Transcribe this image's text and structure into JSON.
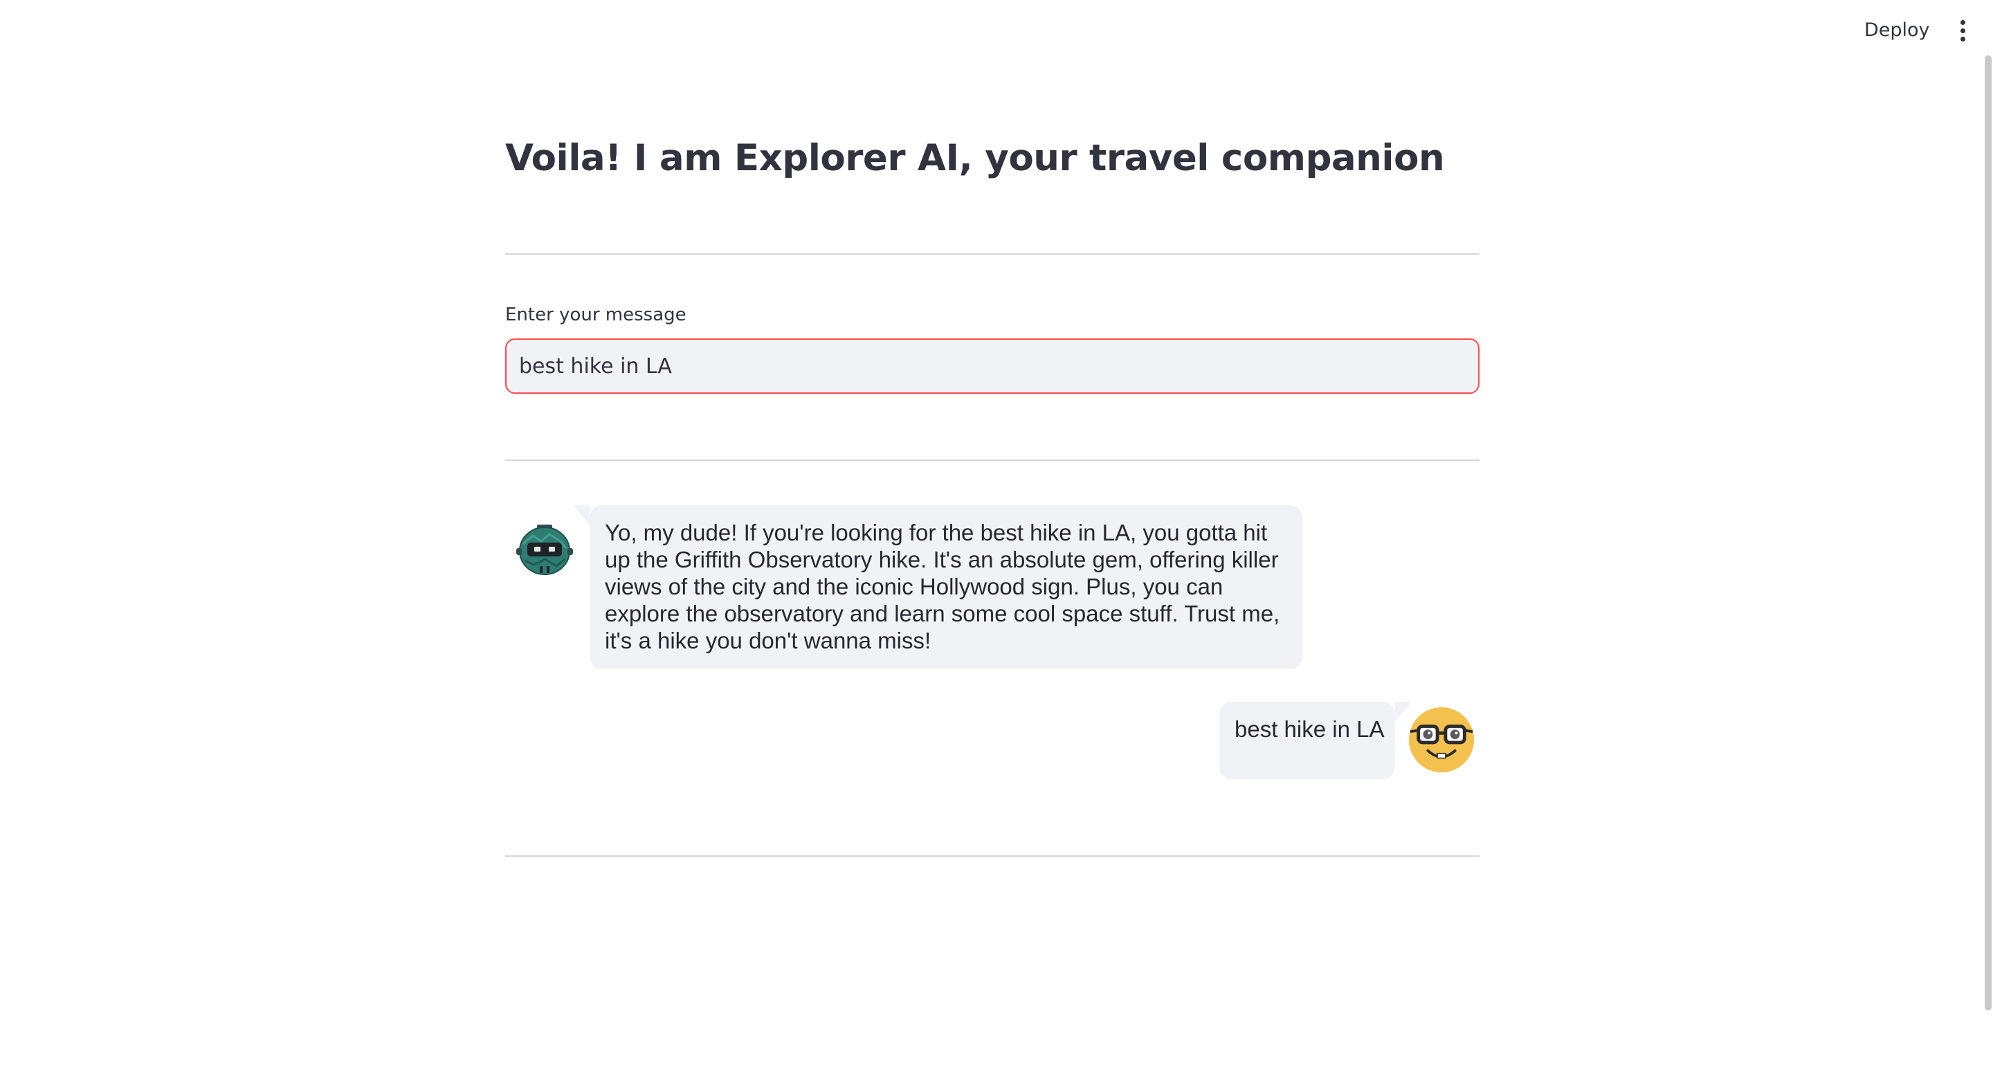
{
  "header": {
    "deploy_label": "Deploy",
    "menu_icon": "more-vertical-icon"
  },
  "main": {
    "title": "Voila! I am Explorer AI, your travel companion",
    "input": {
      "label": "Enter your message",
      "value": "best hike in LA",
      "focus_color": "#ff4b4b"
    }
  },
  "chat": {
    "messages": [
      {
        "role": "bot",
        "avatar_icon": "robot-avatar-icon",
        "text": "Yo, my dude! If you're looking for the best hike in LA, you gotta hit up the Griffith Observatory hike. It's an absolute gem, offering killer views of the city and the iconic Hollywood sign. Plus, you can explore the observatory and learn some cool space stuff. Trust me, it's a hike you don't wanna miss!"
      },
      {
        "role": "user",
        "avatar_icon": "nerd-face-icon",
        "text": "best hike in LA"
      }
    ]
  },
  "colors": {
    "bubble_bg": "#f0f2f6",
    "text": "#31333f",
    "accent": "#ff4b4b"
  }
}
